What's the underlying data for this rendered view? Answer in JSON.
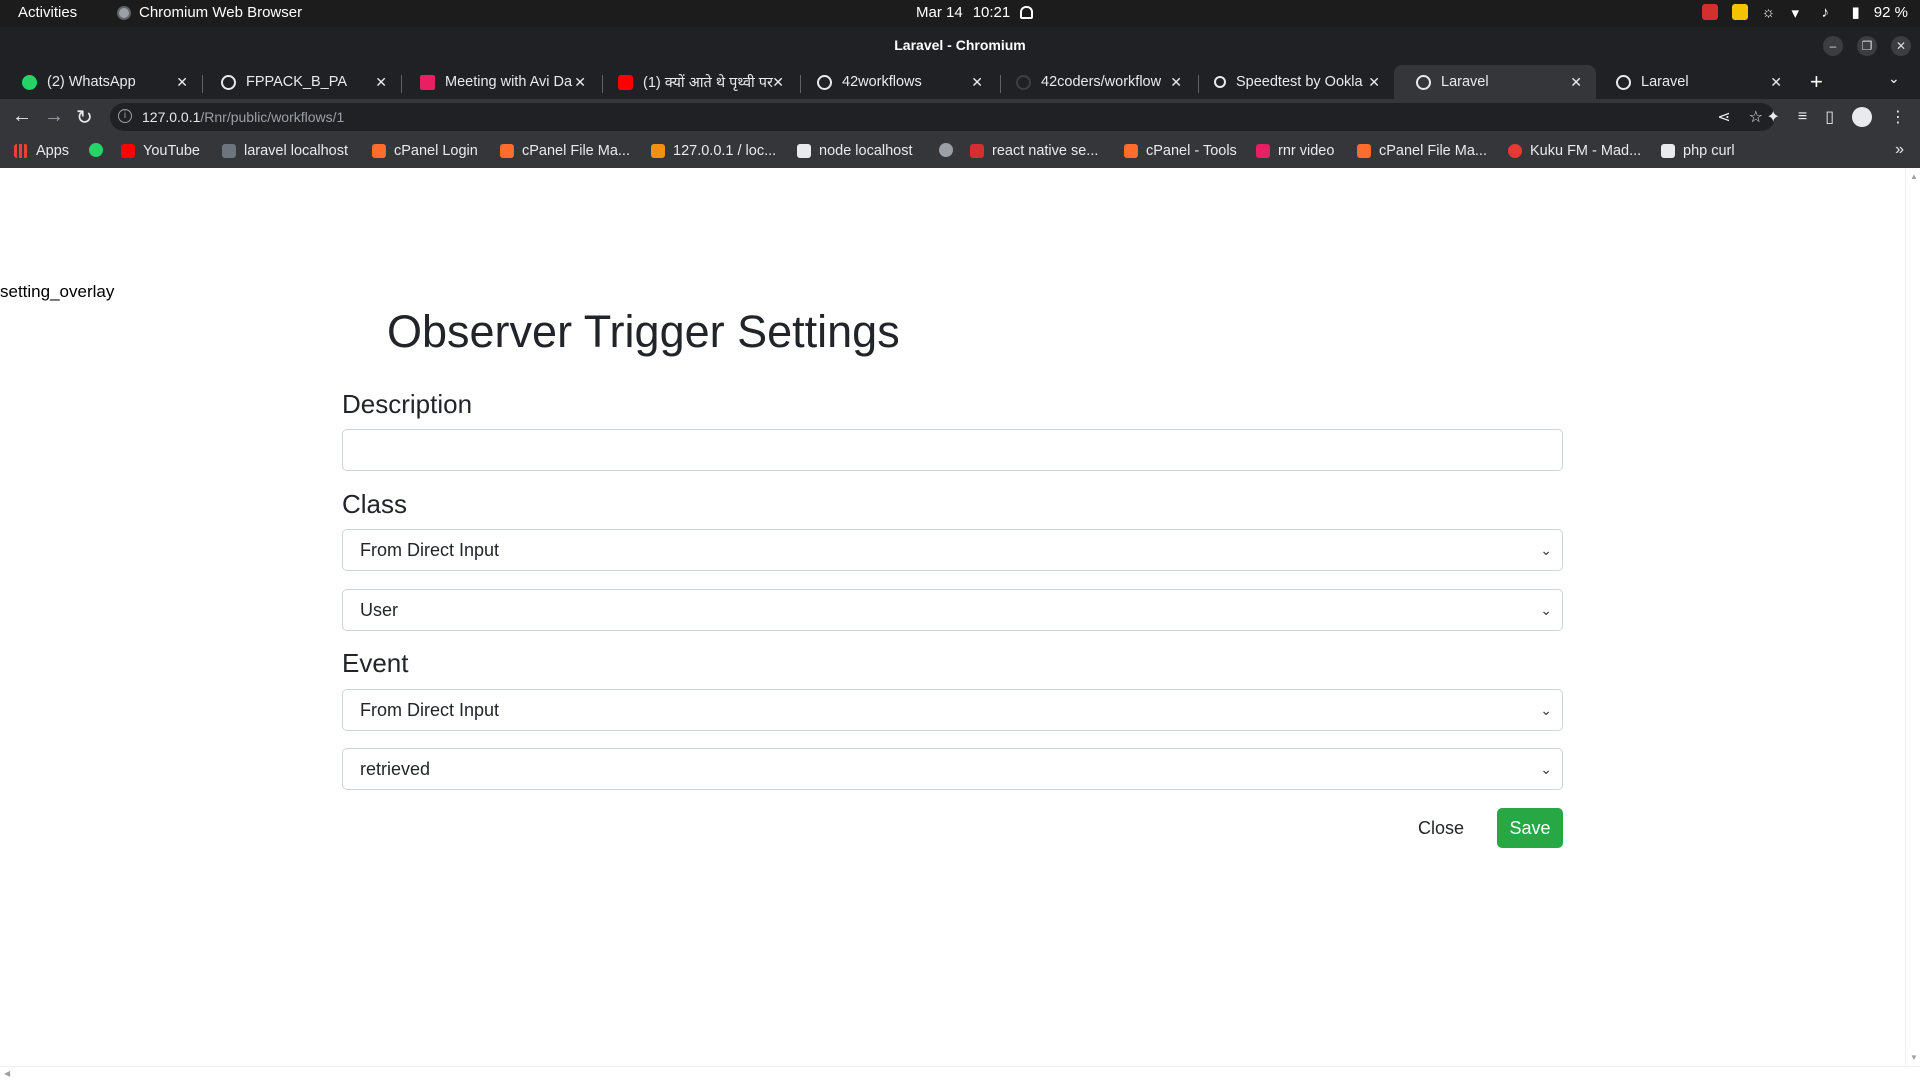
{
  "os": {
    "activities": "Activities",
    "app_name": "Chromium Web Browser",
    "date": "Mar 14",
    "time": "10:21",
    "battery": "92 %"
  },
  "window": {
    "title": "Laravel - Chromium"
  },
  "tabs": [
    {
      "label": "(2) WhatsApp",
      "icon": "whatsapp-icon",
      "color": "#25d366"
    },
    {
      "label": "FPPACK_B_PA",
      "icon": "globe-icon",
      "color": "#e8eaed"
    },
    {
      "label": "Meeting with Avi Da",
      "icon": "play-icon",
      "color": "#e91e63"
    },
    {
      "label": "(1) क्यों आते थे पृथ्वी पर",
      "icon": "youtube-icon",
      "color": "#ff0000"
    },
    {
      "label": "42workflows",
      "icon": "globe-icon",
      "color": "#e8eaed"
    },
    {
      "label": "42coders/workflow",
      "icon": "github-icon",
      "color": "#202124"
    },
    {
      "label": "Speedtest by Ookla",
      "icon": "speedtest-icon",
      "color": "#e8eaed"
    },
    {
      "label": "Laravel",
      "icon": "globe-icon",
      "color": "#e8eaed"
    },
    {
      "label": "Laravel",
      "icon": "globe-icon",
      "color": "#e8eaed"
    }
  ],
  "toolbar": {
    "url_host": "127.0.0.1",
    "url_path": "/Rnr/public/workflows/1"
  },
  "bookmarks": [
    {
      "label": "Apps",
      "icon": "apps-grid-icon",
      "color": "#ea4335"
    },
    {
      "label": "",
      "icon": "whatsapp-icon",
      "color": "#25d366"
    },
    {
      "label": "YouTube",
      "icon": "youtube-icon",
      "color": "#ff0000"
    },
    {
      "label": "laravel localhost",
      "icon": "de-icon",
      "color": "#6c757d"
    },
    {
      "label": "cPanel Login",
      "icon": "cpanel-icon",
      "color": "#ff6c2c"
    },
    {
      "label": "cPanel File Ma...",
      "icon": "cpanel-icon",
      "color": "#ff6c2c"
    },
    {
      "label": "127.0.0.1 / loc...",
      "icon": "phpmyadmin-icon",
      "color": "#f29111"
    },
    {
      "label": "node localhost",
      "icon": "hash-icon",
      "color": "#e8eaed"
    },
    {
      "label": "",
      "icon": "globe-icon",
      "color": "#9aa0a6"
    },
    {
      "label": "react native se...",
      "icon": "n-icon",
      "color": "#d32f2f"
    },
    {
      "label": "cPanel - Tools",
      "icon": "cpanel-icon",
      "color": "#ff6c2c"
    },
    {
      "label": "rnr video",
      "icon": "play-icon",
      "color": "#e91e63"
    },
    {
      "label": "cPanel File Ma...",
      "icon": "cpanel-icon",
      "color": "#ff6c2c"
    },
    {
      "label": "Kuku FM - Mad...",
      "icon": "kuku-icon",
      "color": "#e53935"
    },
    {
      "label": "php curl",
      "icon": "cb-icon",
      "color": "#e8eaed"
    }
  ],
  "page": {
    "overlay_label": "setting_overlay",
    "heading": "Observer Trigger Settings",
    "description_label": "Description",
    "description_value": "",
    "class_label": "Class",
    "class_source": "From Direct Input",
    "class_value": "User",
    "event_label": "Event",
    "event_source": "From Direct Input",
    "event_value": "retrieved",
    "close_label": "Close",
    "save_label": "Save"
  },
  "colors": {
    "save_button": "#28a745",
    "tab_active": "#35363a",
    "chrome_dark": "#202124"
  }
}
